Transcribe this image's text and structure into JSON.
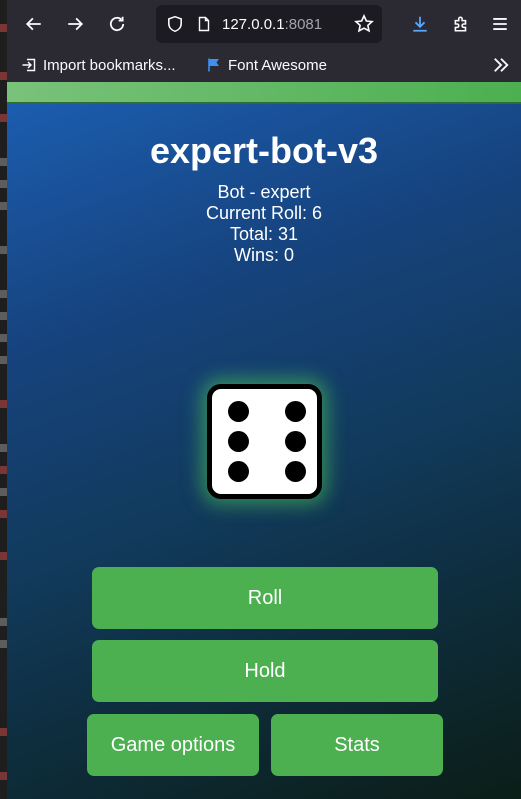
{
  "browser": {
    "url_host": "127.0.0.1",
    "url_port": ":8081",
    "bookmarks": [
      {
        "label": "Import bookmarks...",
        "icon": "import-icon"
      },
      {
        "label": "Font Awesome",
        "icon": "flag-icon"
      }
    ]
  },
  "game": {
    "bot_name": "expert-bot-v3",
    "bot_type": "Bot - expert",
    "current_roll": "Current Roll: 6",
    "total": "Total: 31",
    "wins": "Wins: 0",
    "die_value": 6
  },
  "buttons": {
    "roll": "Roll",
    "hold": "Hold",
    "game_options": "Game options",
    "stats": "Stats"
  },
  "colors": {
    "accent_green": "#4caf50",
    "link_blue": "#55a7ff"
  }
}
